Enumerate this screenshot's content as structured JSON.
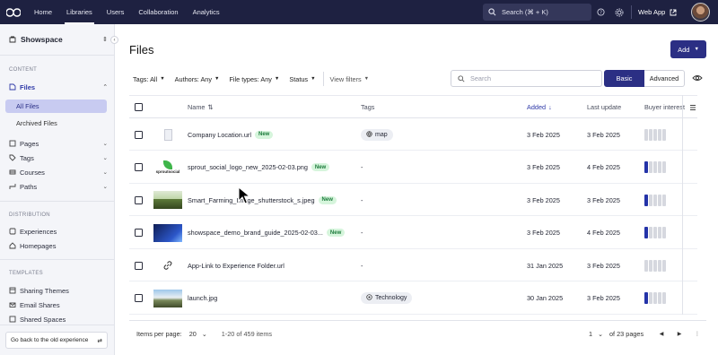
{
  "topnav": {
    "tabs": [
      "Home",
      "Libraries",
      "Users",
      "Collaboration",
      "Analytics"
    ],
    "active_index": 1,
    "search_label": "Search (⌘ + K)",
    "webapp_label": "Web App"
  },
  "sidebar": {
    "workspace": "Showspace",
    "content_label": "CONTENT",
    "files_label": "Files",
    "all_files": "All Files",
    "archived_files": "Archived Files",
    "pages": "Pages",
    "tags": "Tags",
    "courses": "Courses",
    "paths": "Paths",
    "distribution_label": "DISTRIBUTION",
    "experiences": "Experiences",
    "homepages": "Homepages",
    "templates_label": "TEMPLATES",
    "sharing_themes": "Sharing Themes",
    "email_shares": "Email Shares",
    "shared_spaces": "Shared Spaces",
    "old_experience": "Go back to the old experience"
  },
  "main": {
    "title": "Files",
    "add_label": "Add",
    "filters": {
      "tags": "Tags: All",
      "authors": "Authors: Any",
      "file_types": "File types: Any",
      "status": "Status",
      "view_filters": "View filters"
    },
    "search_placeholder": "Search",
    "mode_basic": "Basic",
    "mode_advanced": "Advanced"
  },
  "table": {
    "columns": {
      "name": "Name",
      "tags": "Tags",
      "added": "Added",
      "last_update": "Last update",
      "buyer_interest": "Buyer interest"
    },
    "new_badge": "New",
    "rows": [
      {
        "name": "Company Location.url",
        "is_new": true,
        "tag": "map",
        "tag_icon": "globe-icon",
        "added": "3 Feb 2025",
        "updated": "3 Feb 2025",
        "interest": 0,
        "thumb": "doc"
      },
      {
        "name": "sprout_social_logo_new_2025-02-03.png",
        "is_new": true,
        "tag": "-",
        "added": "3 Feb 2025",
        "updated": "4 Feb 2025",
        "interest": 1,
        "thumb": "sprout"
      },
      {
        "name": "Smart_Farming_Image_shutterstock_s.jpeg",
        "is_new": true,
        "tag": "-",
        "added": "3 Feb 2025",
        "updated": "3 Feb 2025",
        "interest": 1,
        "thumb": "farm"
      },
      {
        "name": "showspace_demo_brand_guide_2025-02-03...",
        "is_new": true,
        "tag": "-",
        "added": "3 Feb 2025",
        "updated": "4 Feb 2025",
        "interest": 1,
        "thumb": "brand"
      },
      {
        "name": "App-Link to Experience Folder.url",
        "is_new": false,
        "tag": "-",
        "added": "31 Jan 2025",
        "updated": "3 Feb 2025",
        "interest": 0,
        "thumb": "link"
      },
      {
        "name": "launch.jpg",
        "is_new": false,
        "tag": "Technology",
        "tag_icon": "technology-icon",
        "added": "30 Jan 2025",
        "updated": "3 Feb 2025",
        "interest": 1,
        "thumb": "launch"
      }
    ]
  },
  "footer": {
    "items_per_page_label": "Items per page:",
    "items_per_page": "20",
    "range": "1-20 of 459 items",
    "page": "1",
    "of_pages": "of 23 pages"
  },
  "colors": {
    "nav_bg": "#1e2141",
    "accent": "#2b2f84",
    "active_item_bg": "#c8cbf1",
    "interest_on": "#2433a8",
    "new_badge_bg": "#d6f5dc"
  }
}
